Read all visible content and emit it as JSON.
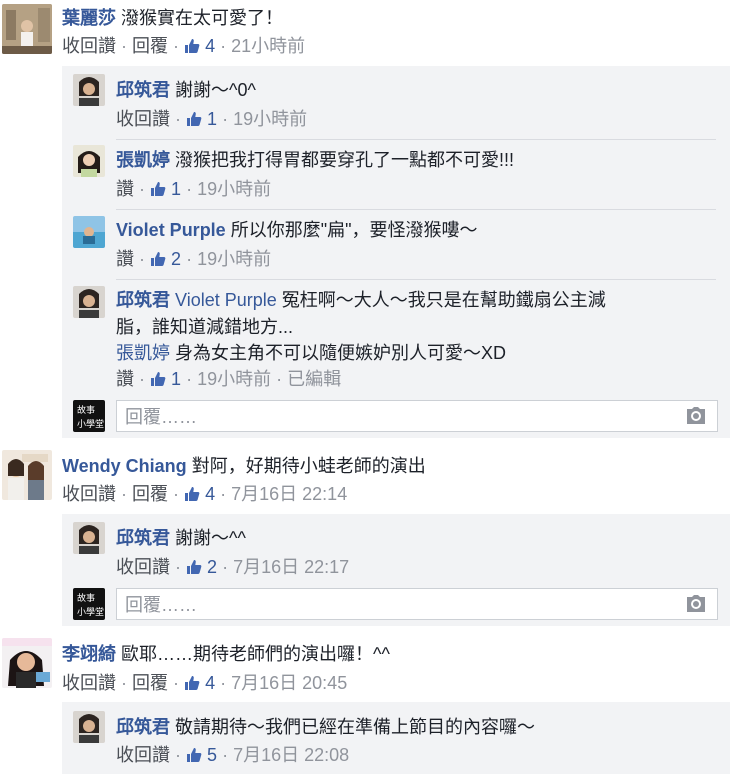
{
  "comments": [
    {
      "author": "葉麗莎",
      "text": "潑猴實在太可愛了！",
      "actions": {
        "unlike": "收回讚",
        "reply": "回覆",
        "likes": "4",
        "time": "21小時前"
      },
      "replies": [
        {
          "author": "邱筑君",
          "text": "謝謝～^0^",
          "actions": {
            "unlike": "收回讚",
            "likes": "1",
            "time": "19小時前"
          }
        },
        {
          "author": "張凱婷",
          "text": "潑猴把我打得胃都要穿孔了一點都不可愛!!!",
          "actions": {
            "like": "讚",
            "likes": "1",
            "time": "19小時前"
          }
        },
        {
          "author": "Violet Purple",
          "text": "所以你那麼\"扁\"，要怪潑猴嘍～",
          "actions": {
            "like": "讚",
            "likes": "2",
            "time": "19小時前"
          }
        },
        {
          "author": "邱筑君",
          "mention": "Violet Purple",
          "text_line1": "冤枉啊～大人～我只是在幫助鐵扇公主減",
          "text_line2": "脂，誰知道減錯地方...",
          "mention2": "張凱婷",
          "text_line3": "身為女主角不可以隨便嫉妒別人可愛～XD",
          "actions": {
            "like": "讚",
            "likes": "1",
            "time": "19小時前",
            "edited": "已編輯"
          }
        }
      ],
      "composer_placeholder": "回覆……"
    },
    {
      "author": "Wendy Chiang",
      "text": "對阿，好期待小蛙老師的演出",
      "actions": {
        "unlike": "收回讚",
        "reply": "回覆",
        "likes": "4",
        "time": "7月16日 22:14"
      },
      "replies": [
        {
          "author": "邱筑君",
          "text": "謝謝～^^",
          "actions": {
            "unlike": "收回讚",
            "likes": "2",
            "time": "7月16日 22:17"
          }
        }
      ],
      "composer_placeholder": "回覆……"
    },
    {
      "author": "李翊綺",
      "text": "歐耶……期待老師們的演出囉！^^",
      "actions": {
        "unlike": "收回讚",
        "reply": "回覆",
        "likes": "4",
        "time": "7月16日 20:45"
      },
      "replies": [
        {
          "author": "邱筑君",
          "text": "敬請期待～我們已經在準備上節目的內容囉～",
          "actions": {
            "unlike": "收回讚",
            "likes": "5",
            "time": "7月16日 22:08"
          }
        }
      ]
    }
  ],
  "separator": "·",
  "colors": {
    "link_blue": "#365899",
    "meta_gray": "#90949c",
    "reply_bg": "#f2f3f5"
  },
  "icons": {
    "like": "thumbs-up-icon",
    "camera": "camera-icon"
  }
}
